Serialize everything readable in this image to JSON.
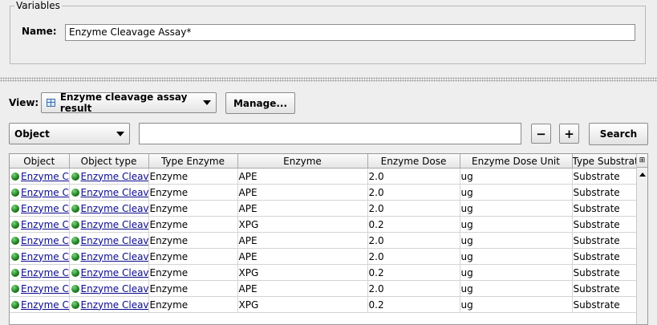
{
  "variables": {
    "legend": "Variables",
    "name_label": "Name:",
    "name_value": "Enzyme Cleavage Assay*"
  },
  "view": {
    "label": "View:",
    "selected": "Enzyme cleavage assay result",
    "manage_label": "Manage..."
  },
  "search": {
    "field_selected": "Object",
    "query": "",
    "minus_label": "−",
    "plus_label": "+",
    "search_label": "Search"
  },
  "table": {
    "columns": [
      "Object",
      "Object type",
      "Type Enzyme",
      "Enzyme",
      "Enzyme Dose",
      "Enzyme Dose Unit",
      "Type Substrate"
    ],
    "rows": [
      {
        "object": "Enzyme Cleavage Assay",
        "object_type": "Enzyme Cleavage Assay",
        "type_enzyme": "Enzyme",
        "enzyme": "APE",
        "dose": "2.0",
        "unit": "ug",
        "type_substrate": "Substrate"
      },
      {
        "object": "Enzyme Cleavage Assay",
        "object_type": "Enzyme Cleavage Assay",
        "type_enzyme": "Enzyme",
        "enzyme": "APE",
        "dose": "2.0",
        "unit": "ug",
        "type_substrate": "Substrate"
      },
      {
        "object": "Enzyme Cleavage Assay",
        "object_type": "Enzyme Cleavage Assay",
        "type_enzyme": "Enzyme",
        "enzyme": "APE",
        "dose": "2.0",
        "unit": "ug",
        "type_substrate": "Substrate"
      },
      {
        "object": "Enzyme Cleavage Assay",
        "object_type": "Enzyme Cleavage Assay",
        "type_enzyme": "Enzyme",
        "enzyme": "XPG",
        "dose": "0.2",
        "unit": "ug",
        "type_substrate": "Substrate"
      },
      {
        "object": "Enzyme Cleavage Assay",
        "object_type": "Enzyme Cleavage Assay",
        "type_enzyme": "Enzyme",
        "enzyme": "APE",
        "dose": "2.0",
        "unit": "ug",
        "type_substrate": "Substrate"
      },
      {
        "object": "Enzyme Cleavage Assay",
        "object_type": "Enzyme Cleavage Assay",
        "type_enzyme": "Enzyme",
        "enzyme": "APE",
        "dose": "2.0",
        "unit": "ug",
        "type_substrate": "Substrate"
      },
      {
        "object": "Enzyme Cleavage Assay",
        "object_type": "Enzyme Cleavage Assay",
        "type_enzyme": "Enzyme",
        "enzyme": "XPG",
        "dose": "0.2",
        "unit": "ug",
        "type_substrate": "Substrate"
      },
      {
        "object": "Enzyme Cleavage Assay",
        "object_type": "Enzyme Cleavage Assay",
        "type_enzyme": "Enzyme",
        "enzyme": "APE",
        "dose": "2.0",
        "unit": "ug",
        "type_substrate": "Substrate"
      },
      {
        "object": "Enzyme Cleavage Assay",
        "object_type": "Enzyme Cleavage Assay",
        "type_enzyme": "Enzyme",
        "enzyme": "XPG",
        "dose": "0.2",
        "unit": "ug",
        "type_substrate": "Substrate"
      }
    ]
  },
  "colors": {
    "background": "#eeeeee",
    "link": "#0a0a8a",
    "status_dot": "#1e7a1e"
  },
  "icons": {
    "view_icon": "table-icon",
    "row_status_icon": "green-circle-icon",
    "column_chooser_icon": "column-chooser-icon"
  }
}
